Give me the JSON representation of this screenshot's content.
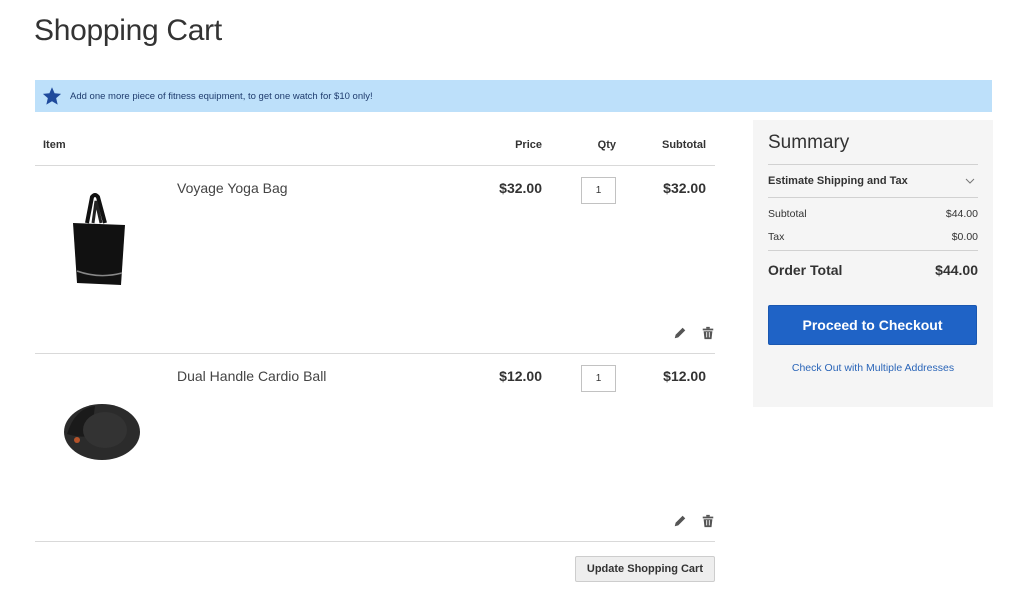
{
  "page": {
    "title": "Shopping Cart"
  },
  "promo": {
    "icon": "star-icon",
    "message": "Add one more piece of fitness equipment, to get one watch for $10 only!",
    "bg_color": "#bde0fa",
    "icon_color": "#1f4a9c"
  },
  "cart": {
    "columns": {
      "item": "Item",
      "price": "Price",
      "qty": "Qty",
      "subtotal": "Subtotal"
    },
    "items": [
      {
        "name": "Voyage Yoga Bag",
        "image": "tote-bag-image",
        "price": "$32.00",
        "qty": "1",
        "subtotal": "$32.00",
        "actions": {
          "edit_icon": "pencil-icon",
          "delete_icon": "trash-icon"
        }
      },
      {
        "name": "Dual Handle Cardio Ball",
        "image": "cardio-ball-image",
        "price": "$12.00",
        "qty": "1",
        "subtotal": "$12.00",
        "actions": {
          "edit_icon": "pencil-icon",
          "delete_icon": "trash-icon"
        }
      }
    ],
    "update_label": "Update Shopping Cart"
  },
  "summary": {
    "title": "Summary",
    "estimate_label": "Estimate Shipping and Tax",
    "subtotal_label": "Subtotal",
    "subtotal_value": "$44.00",
    "tax_label": "Tax",
    "tax_value": "$0.00",
    "order_total_label": "Order Total",
    "order_total_value": "$44.00",
    "checkout_label": "Proceed to Checkout",
    "multi_address_label": "Check Out with Multiple Addresses",
    "accent_color": "#1f63c6"
  }
}
